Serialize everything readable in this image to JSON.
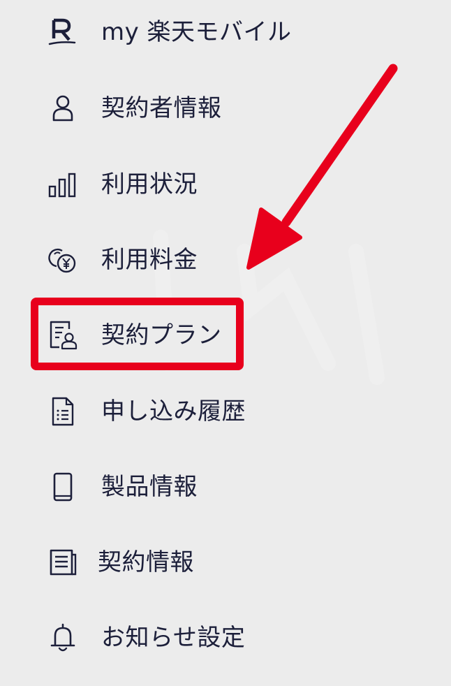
{
  "menu": {
    "items": [
      {
        "label": "my 楽天モバイル",
        "icon": "rakuten-r-icon"
      },
      {
        "label": "契約者情報",
        "icon": "person-icon"
      },
      {
        "label": "利用状況",
        "icon": "bar-chart-icon"
      },
      {
        "label": "利用料金",
        "icon": "yen-coins-icon"
      },
      {
        "label": "契約プラン",
        "icon": "plan-person-icon"
      },
      {
        "label": "申し込み履歴",
        "icon": "document-list-icon"
      },
      {
        "label": "製品情報",
        "icon": "smartphone-icon"
      },
      {
        "label": "契約情報",
        "icon": "notebook-icon"
      },
      {
        "label": "お知らせ設定",
        "icon": "bell-icon"
      }
    ]
  },
  "annotation": {
    "highlight_color": "#e8001c",
    "highlighted_item": "契約プラン"
  },
  "colors": {
    "background": "#ececec",
    "text": "#1c1f3a",
    "accent": "#e8001c"
  }
}
